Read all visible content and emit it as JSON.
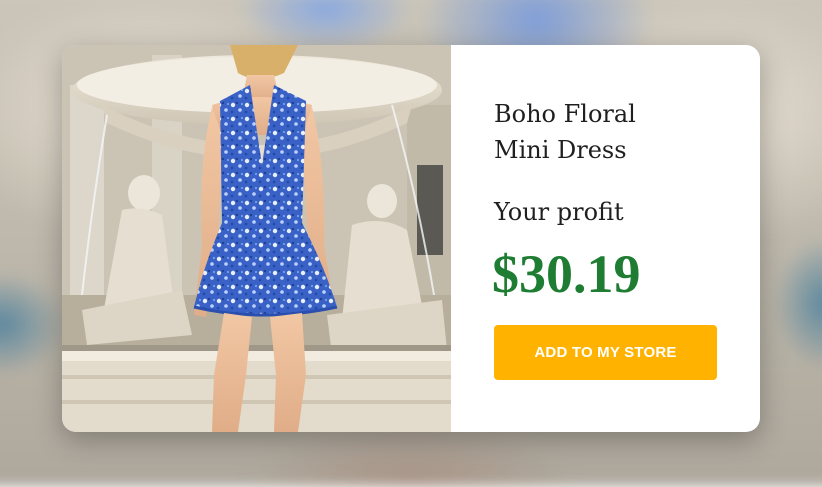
{
  "product": {
    "name": "Boho Floral\nMini Dress",
    "profit_label": "Your profit",
    "profit_value": "$30.19"
  },
  "actions": {
    "add_to_store_label": "ADD TO MY STORE"
  },
  "colors": {
    "profit": "#1e7d32",
    "button": "#ffb300",
    "button_text": "#ffffff",
    "dress_primary": "#3b63c9",
    "card_background": "#ffffff"
  },
  "image": {
    "subject": "model in blue floral halter mini dress in front of a stone fountain with statues"
  }
}
